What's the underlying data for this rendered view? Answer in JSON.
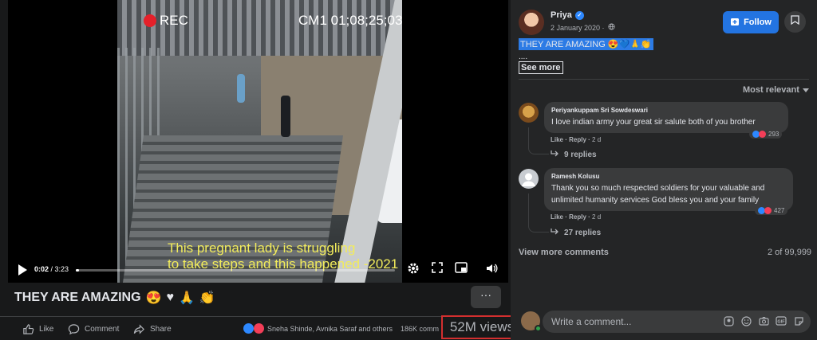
{
  "video": {
    "rec_label": "REC",
    "cm_label": "CM1 01;08;25;03",
    "subtitle_line1": "This pregnant lady is struggling",
    "subtitle_line2": "to take steps and this happened -2021",
    "current_time": "0:02",
    "duration": "/ 3:23",
    "progress_fraction": 0.01
  },
  "post": {
    "title": "THEY ARE AMAZING",
    "title_emojis": [
      "😍",
      "♥",
      "🙏",
      "👏"
    ],
    "more_label": "···",
    "like_label": "Like",
    "comment_label": "Comment",
    "share_label": "Share",
    "reactors_text": "Sneha Shinde, Avnika Saraf and others",
    "comments_count": "186K comm",
    "views": "52M views"
  },
  "author": {
    "name": "Priya",
    "date": "2 January 2020 ·",
    "follow_label": "Follow",
    "caption": "THEY ARE AMAZING 😍💙🙏👏",
    "ellipsis": "....",
    "see_more": "See more"
  },
  "comments_header": {
    "sort_label": "Most relevant"
  },
  "comments": [
    {
      "name": "Periyankuppam Sri Sowdeswari",
      "text": "I love indian army your great sir salute both of you brother",
      "like": "Like",
      "reply": "Reply",
      "age": "2 d",
      "reactions": "293",
      "replies": "9 replies"
    },
    {
      "name": "Ramesh Kolusu",
      "text_line1": "Thank you so much respected soldiers for your valuable and",
      "text_line2": "unlimited humanity services God bless you and your family",
      "like": "Like",
      "reply": "Reply",
      "age": "2 d",
      "reactions": "427",
      "replies": "27 replies"
    }
  ],
  "footer": {
    "view_more": "View more comments",
    "count": "2 of 99,999",
    "placeholder": "Write a comment..."
  },
  "colors": {
    "accent": "#2374e1",
    "background": "#18191a",
    "panel": "#242526",
    "highlight_box": "#d32f2f"
  }
}
